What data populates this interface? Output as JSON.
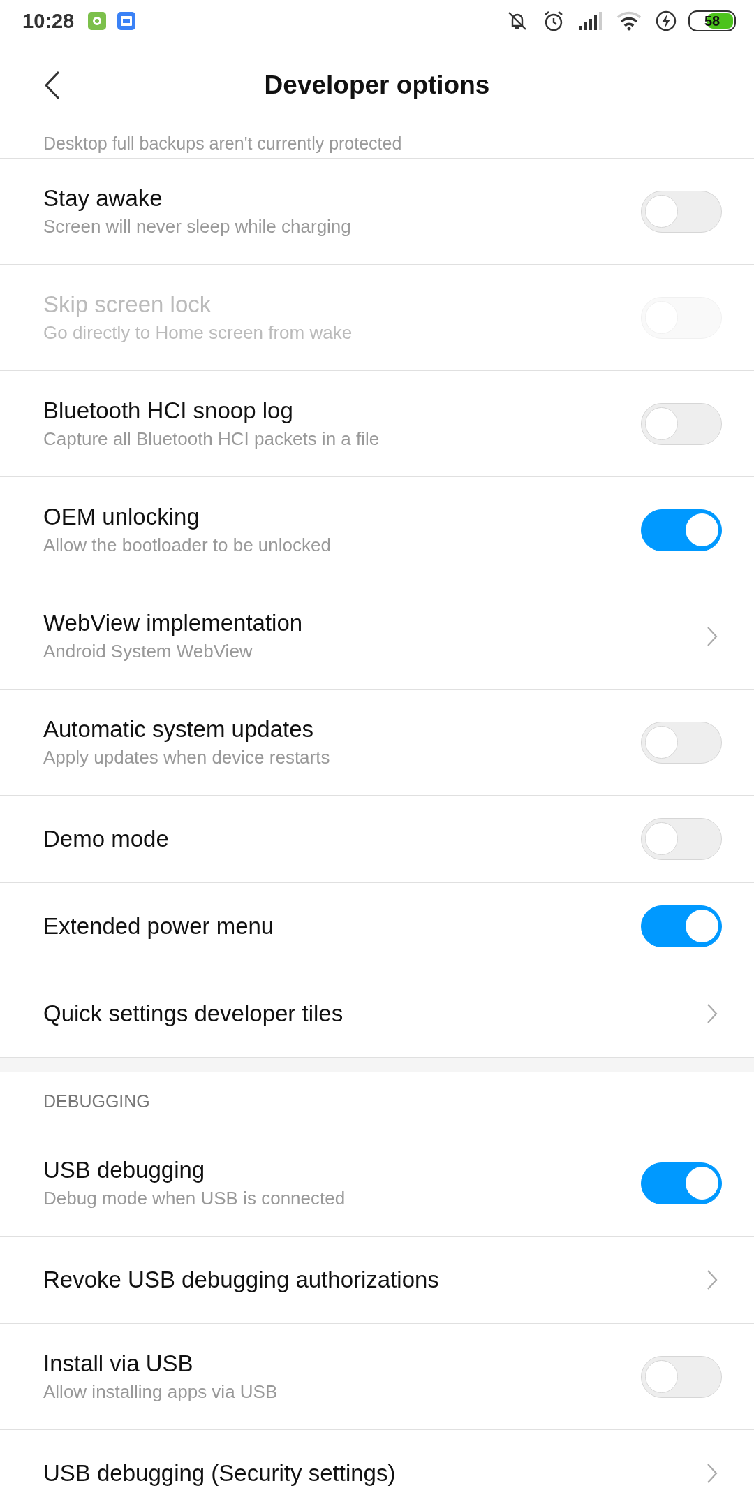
{
  "status_bar": {
    "time": "10:28",
    "battery": "58"
  },
  "title": "Developer options",
  "cut_off_summary": "Desktop full backups aren't currently protected",
  "sections": [
    {
      "items": [
        {
          "kind": "toggle",
          "title": "Stay awake",
          "summary": "Screen will never sleep while charging",
          "on": false,
          "disabled": false
        },
        {
          "kind": "toggle",
          "title": "Skip screen lock",
          "summary": "Go directly to Home screen from wake",
          "on": false,
          "disabled": true
        },
        {
          "kind": "toggle",
          "title": "Bluetooth HCI snoop log",
          "summary": "Capture all Bluetooth HCI packets in a file",
          "on": false,
          "disabled": false
        },
        {
          "kind": "toggle",
          "title": "OEM unlocking",
          "summary": "Allow the bootloader to be unlocked",
          "on": true,
          "disabled": false
        },
        {
          "kind": "link",
          "title": "WebView implementation",
          "summary": "Android System WebView"
        },
        {
          "kind": "toggle",
          "title": "Automatic system updates",
          "summary": "Apply updates when device restarts",
          "on": false,
          "disabled": false
        },
        {
          "kind": "toggle",
          "title": "Demo mode",
          "on": false,
          "disabled": false
        },
        {
          "kind": "toggle",
          "title": "Extended power menu",
          "on": true,
          "disabled": false
        },
        {
          "kind": "link",
          "title": "Quick settings developer tiles"
        }
      ]
    },
    {
      "header": "DEBUGGING",
      "items": [
        {
          "kind": "toggle",
          "title": "USB debugging",
          "summary": "Debug mode when USB is connected",
          "on": true,
          "disabled": false
        },
        {
          "kind": "link",
          "title": "Revoke USB debugging authorizations"
        },
        {
          "kind": "toggle",
          "title": "Install via USB",
          "summary": "Allow installing apps via USB",
          "on": false,
          "disabled": false
        },
        {
          "kind": "link",
          "title": "USB debugging (Security settings)"
        }
      ]
    }
  ]
}
